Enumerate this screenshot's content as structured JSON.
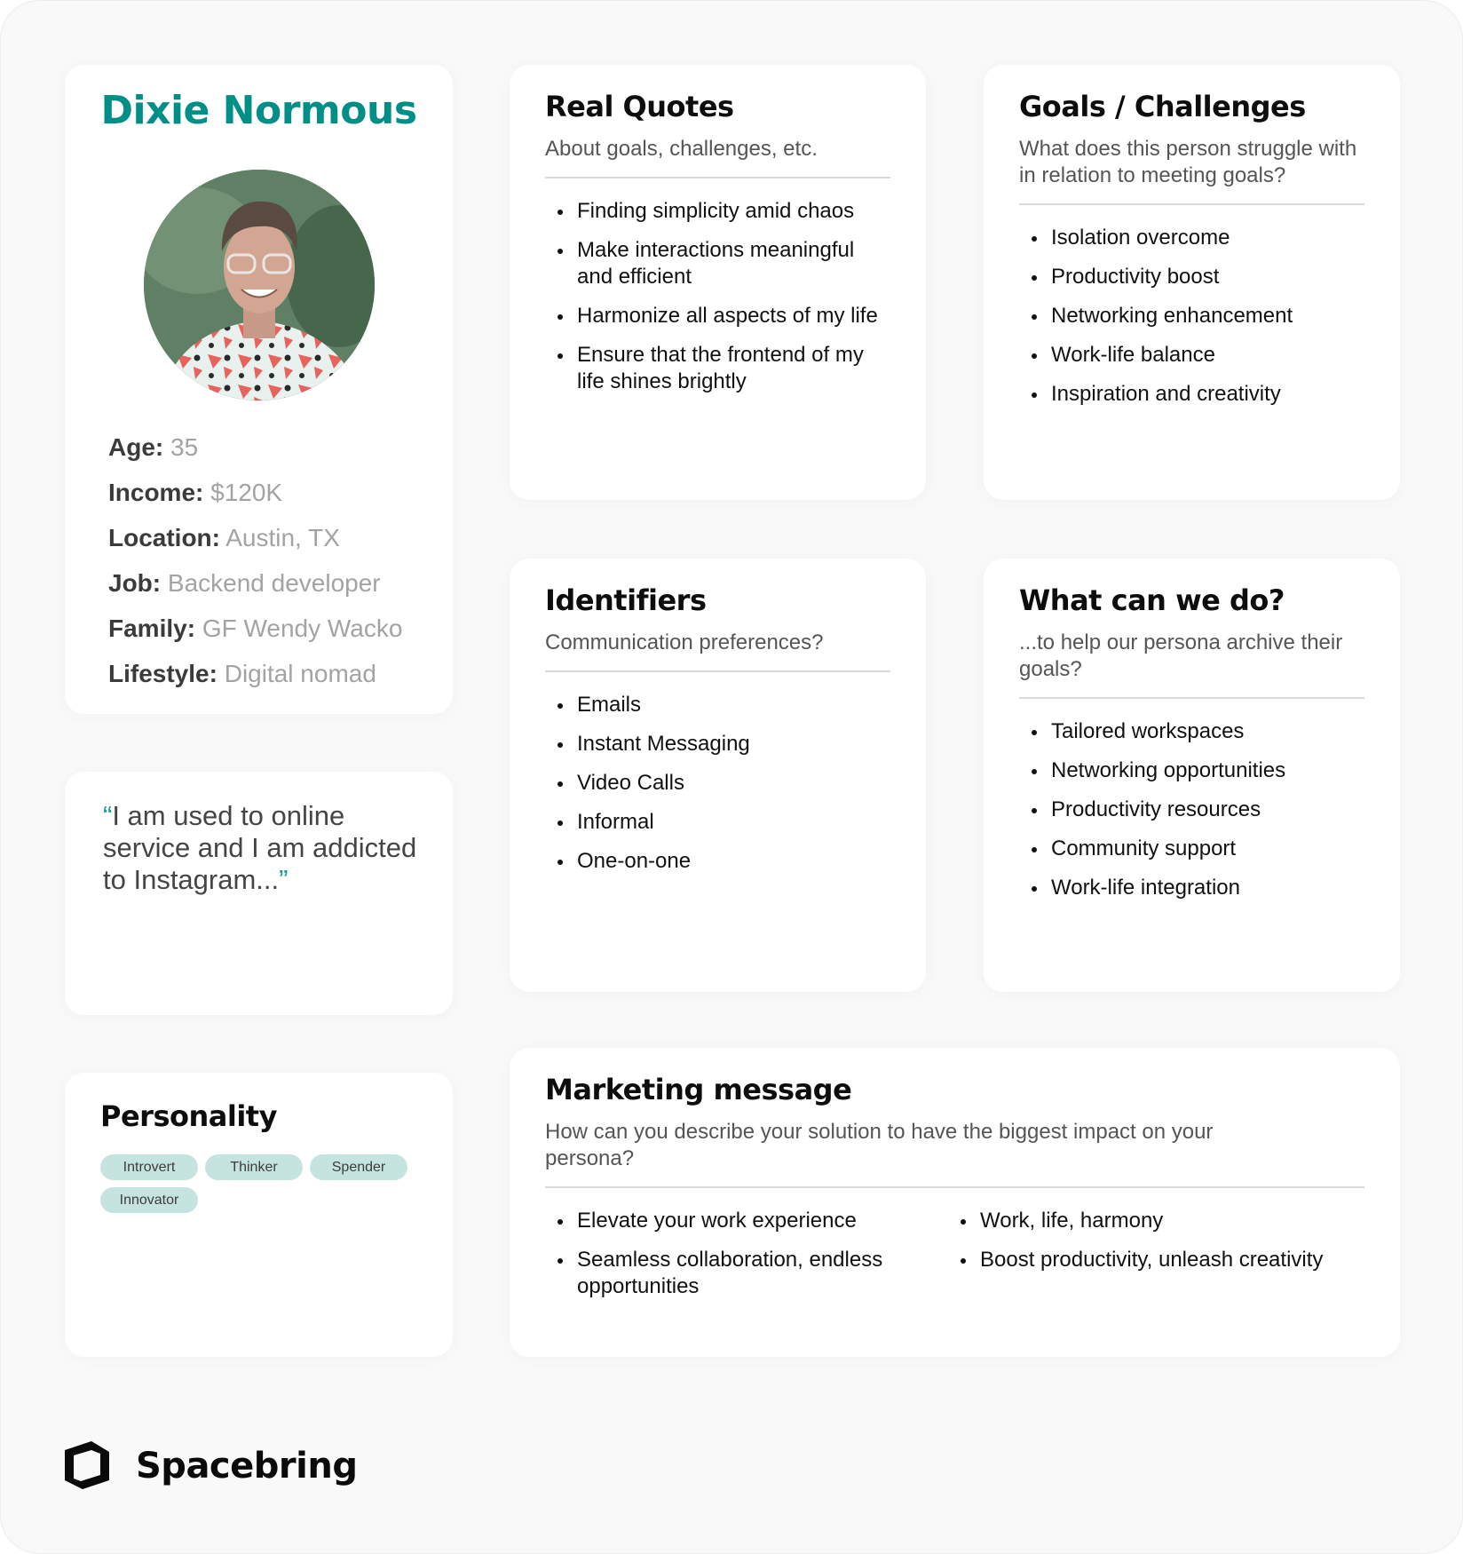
{
  "brand": {
    "name": "Spacebring",
    "icon": "spacebring-logo-icon",
    "accent_color": "#008f86",
    "tag_color": "#c6e4df"
  },
  "profile": {
    "name": "Dixie Normous",
    "photo": "persona-photo",
    "attributes": [
      {
        "label": "Age:",
        "value": "35"
      },
      {
        "label": "Income:",
        "value": "$120K"
      },
      {
        "label": "Location:",
        "value": "Austin, TX"
      },
      {
        "label": "Job:",
        "value": "Backend developer"
      },
      {
        "label": "Family:",
        "value": "GF Wendy Wacko"
      },
      {
        "label": "Lifestyle:",
        "value": "Digital nomad"
      }
    ]
  },
  "quote": {
    "open_mark": "“",
    "text": "I am used to online service and I am addicted to Instagram...",
    "close_mark": "”"
  },
  "personality": {
    "title": "Personality",
    "tags": [
      "Introvert",
      "Thinker",
      "Spender",
      "Innovator"
    ]
  },
  "real_quotes": {
    "title": "Real Quotes",
    "subtitle": "About goals, challenges, etc.",
    "items": [
      "Finding simplicity amid chaos",
      "Make interactions meaningful and efficient",
      "Harmonize all aspects of my life",
      "Ensure that the frontend of my life shines brightly"
    ]
  },
  "goals": {
    "title": "Goals / Challenges",
    "subtitle": "What does this person struggle with in relation to meeting goals?",
    "items": [
      "Isolation overcome",
      "Productivity boost",
      "Networking enhancement",
      "Work-life balance",
      "Inspiration and creativity"
    ]
  },
  "identifiers": {
    "title": "Identifiers",
    "subtitle": "Communication preferences?",
    "items": [
      "Emails",
      "Instant Messaging",
      "Video Calls",
      "Informal",
      "One-on-one"
    ]
  },
  "what_can_we_do": {
    "title": "What can we do?",
    "subtitle": "...to help our persona archive their goals?",
    "items": [
      "Tailored workspaces",
      "Networking opportunities",
      "Productivity resources",
      "Community support",
      "Work-life integration"
    ]
  },
  "marketing": {
    "title": "Marketing message",
    "subtitle": "How can you describe your solution to have the biggest impact on your persona?",
    "items_left": [
      "Elevate your work experience",
      "Seamless collaboration, endless opportunities"
    ],
    "items_right": [
      "Work, life, harmony",
      "Boost productivity, unleash creativity"
    ]
  }
}
